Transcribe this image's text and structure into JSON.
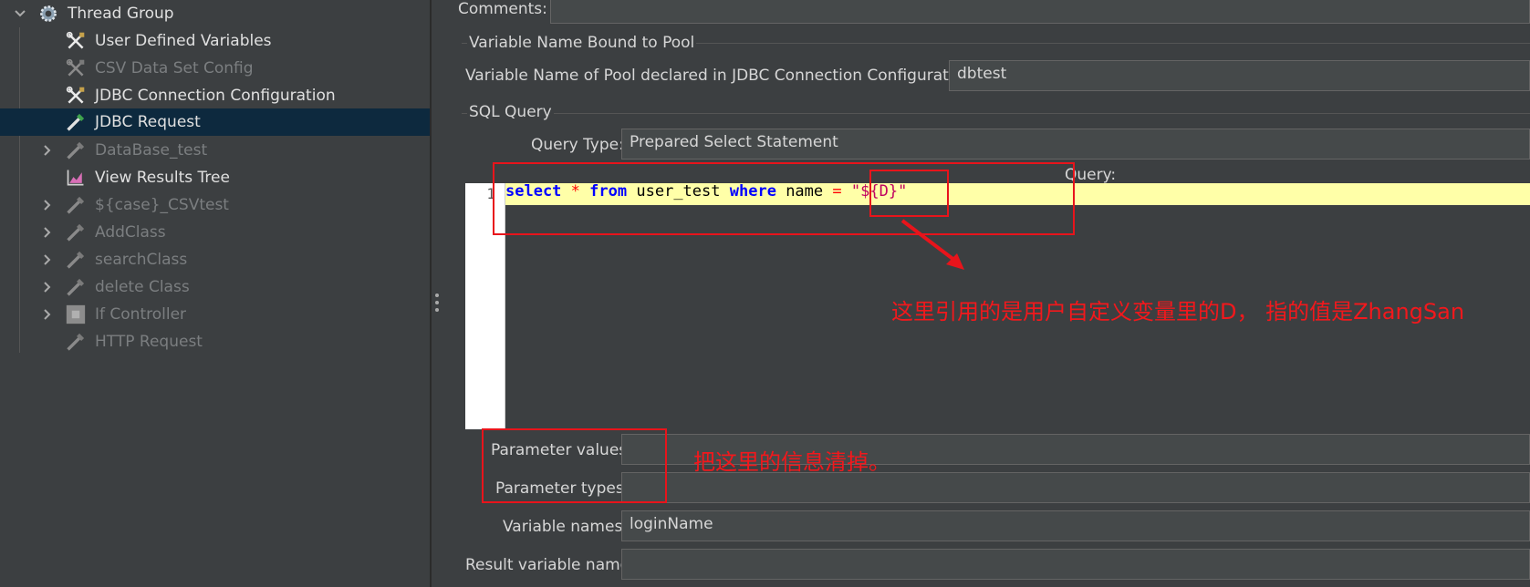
{
  "tree": {
    "items": [
      {
        "label": "Thread Group",
        "icon": "gear-icon",
        "expanded": true,
        "disabled": false
      },
      {
        "label": "User Defined Variables",
        "icon": "config-wrench-icon",
        "disabled": false
      },
      {
        "label": "CSV Data Set Config",
        "icon": "config-wrench-icon",
        "disabled": true
      },
      {
        "label": "JDBC Connection Configuration",
        "icon": "config-wrench-icon",
        "disabled": false
      },
      {
        "label": "JDBC Request",
        "icon": "sampler-pipette-icon",
        "disabled": false,
        "selected": true
      },
      {
        "label": "DataBase_test",
        "icon": "sampler-pipette-icon",
        "disabled": true,
        "collapsed": true
      },
      {
        "label": "View Results Tree",
        "icon": "chart-listener-icon",
        "disabled": false
      },
      {
        "label": "${case}_CSVtest",
        "icon": "sampler-pipette-icon",
        "disabled": true,
        "collapsed": true
      },
      {
        "label": "AddClass",
        "icon": "sampler-pipette-icon",
        "disabled": true,
        "collapsed": true
      },
      {
        "label": "searchClass",
        "icon": "sampler-pipette-icon",
        "disabled": true,
        "collapsed": true
      },
      {
        "label": "delete Class",
        "icon": "sampler-pipette-icon",
        "disabled": true,
        "collapsed": true
      },
      {
        "label": "If Controller",
        "icon": "controller-icon",
        "disabled": true,
        "collapsed": true
      },
      {
        "label": "HTTP Request",
        "icon": "sampler-pipette-icon",
        "disabled": true
      }
    ]
  },
  "form": {
    "comments_label": "Comments:",
    "comments_value": "",
    "pool_section_title": "Variable Name Bound to Pool",
    "pool_label": "Variable Name of Pool declared in JDBC Connection Configuration:",
    "pool_value": "dbtest",
    "sql_section_title": "SQL Query",
    "query_type_label": "Query Type:",
    "query_type_value": "Prepared Select Statement",
    "query_label": "Query:",
    "line_number": "1",
    "code": {
      "kw_select": "select",
      "star": "*",
      "kw_from": "from",
      "table": "user_test",
      "kw_where": "where",
      "column": "name",
      "eq": "=",
      "string": "\"${D}\""
    },
    "param_values_label": "Parameter values:",
    "param_values_value": "",
    "param_types_label": "Parameter types:",
    "param_types_value": "",
    "var_names_label": "Variable names:",
    "var_names_value": "loginName",
    "result_var_label": "Result variable name:",
    "result_var_value": ""
  },
  "annotations": {
    "note_variable": "这里引用的是用户自定义变量里的D， 指的值是ZhangSan",
    "note_clear": "把这里的信息清掉。"
  },
  "colors": {
    "background": "#3c3f41",
    "selection": "#0d293e",
    "annotation_red": "#e8141b",
    "code_line_highlight": "#ffffa8",
    "keyword_blue": "#0000ff",
    "string_magenta": "#c00060"
  }
}
